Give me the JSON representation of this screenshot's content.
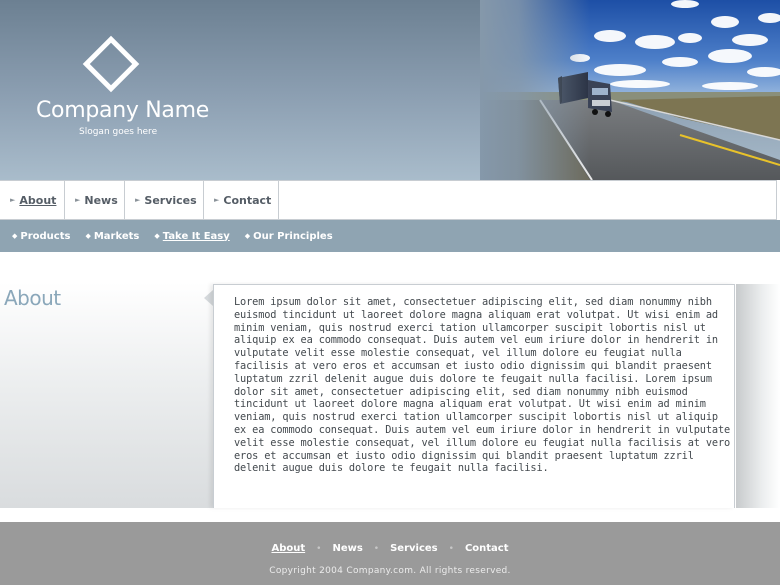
{
  "brand": {
    "company_name": "Company Name",
    "slogan": "Slogan goes here",
    "logo_icon": "diamond-logo-icon"
  },
  "main_nav": {
    "items": [
      {
        "label": "About",
        "active": true
      },
      {
        "label": "News",
        "active": false
      },
      {
        "label": "Services",
        "active": false
      },
      {
        "label": "Contact",
        "active": false
      }
    ]
  },
  "sub_nav": {
    "items": [
      {
        "label": "Products",
        "active": false
      },
      {
        "label": "Markets",
        "active": false
      },
      {
        "label": "Take It Easy",
        "active": true
      },
      {
        "label": "Our Principles",
        "active": false
      }
    ]
  },
  "content": {
    "section_title": "About",
    "body": "Lorem ipsum dolor sit amet, consectetuer adipiscing elit, sed diam nonummy nibh euismod tincidunt ut laoreet dolore magna aliquam erat volutpat. Ut wisi enim ad minim veniam, quis nostrud exerci tation ullamcorper suscipit lobortis nisl ut aliquip ex ea commodo consequat. Duis autem vel eum iriure dolor in hendrerit in vulputate velit esse molestie consequat, vel illum dolore eu feugiat nulla facilisis at vero eros et accumsan et iusto odio dignissim qui blandit praesent luptatum zzril delenit augue duis dolore te feugait nulla facilisi. Lorem ipsum dolor sit amet, consectetuer adipiscing elit, sed diam nonummy nibh euismod tincidunt ut laoreet dolore magna aliquam erat volutpat. Ut wisi enim ad minim veniam, quis nostrud exerci tation ullamcorper suscipit lobortis nisl ut aliquip ex ea commodo consequat. Duis autem vel eum iriure dolor in hendrerit in vulputate velit esse molestie consequat, vel illum dolore eu feugiat nulla facilisis at vero eros et accumsan et iusto odio dignissim qui blandit praesent luptatum zzril delenit augue duis dolore te feugait nulla facilisi."
  },
  "footer": {
    "nav": [
      {
        "label": "About",
        "active": true
      },
      {
        "label": "News",
        "active": false
      },
      {
        "label": "Services",
        "active": false
      },
      {
        "label": "Contact",
        "active": false
      }
    ],
    "separator": "•",
    "copyright": "Copyright 2004 Company.com. All rights reserved."
  },
  "colors": {
    "header_blue": "#7a8fa2",
    "subnav_bg": "#8fa4b2",
    "title_blue": "#8aa7ba",
    "footer_bg": "#9a9a9a"
  }
}
